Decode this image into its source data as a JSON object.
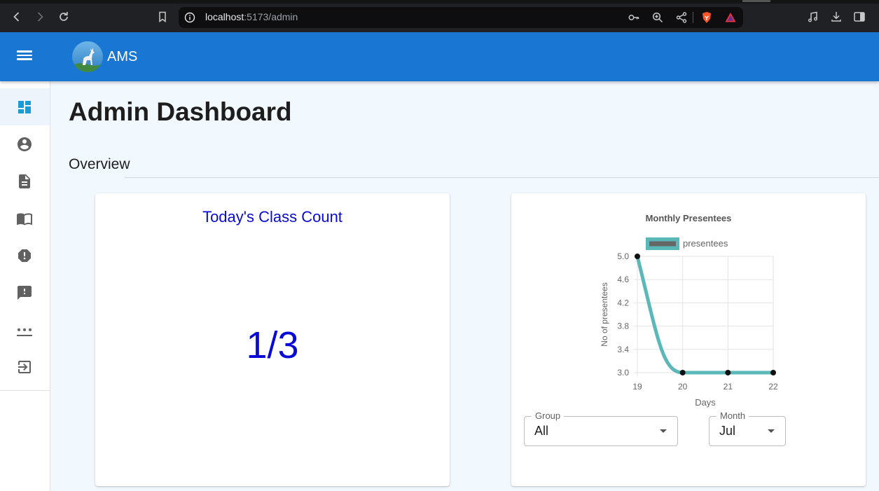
{
  "browser": {
    "url_host": "localhost",
    "url_path": ":5173/admin"
  },
  "appbar": {
    "title": "AMS"
  },
  "sidebar": {
    "items": [
      {
        "icon": "dashboard-icon",
        "active": true
      },
      {
        "icon": "account-circle-icon",
        "active": false
      },
      {
        "icon": "document-icon",
        "active": false
      },
      {
        "icon": "menu-book-icon",
        "active": false
      },
      {
        "icon": "report-icon",
        "active": false
      },
      {
        "icon": "feedback-icon",
        "active": false
      },
      {
        "icon": "password-icon",
        "active": false
      },
      {
        "icon": "logout-icon",
        "active": false
      }
    ]
  },
  "main": {
    "title": "Admin Dashboard",
    "section": "Overview",
    "class_count": {
      "title": "Today's Class Count",
      "value": "1/3"
    },
    "filters": {
      "group": {
        "label": "Group",
        "value": "All"
      },
      "month": {
        "label": "Month",
        "value": "Jul"
      }
    }
  },
  "colors": {
    "appbar": "#1976d2",
    "accent_text": "#0a0ad6",
    "line": "#5ab8b8",
    "active_icon": "#1b9ad8",
    "icon": "#616161"
  },
  "chart_data": {
    "type": "line",
    "title": "Monthly Presentees",
    "xlabel": "Days",
    "ylabel": "No of presentees",
    "x": [
      19,
      20,
      21,
      22
    ],
    "series": [
      {
        "name": "presentees",
        "values": [
          5,
          3,
          3,
          3
        ]
      }
    ],
    "ylim": [
      3.0,
      5.0
    ],
    "yticks": [
      "3.0",
      "3.4",
      "3.8",
      "4.2",
      "4.6",
      "5.0"
    ],
    "xticks": [
      "19",
      "20",
      "21",
      "22"
    ],
    "grid": true,
    "legend": "top"
  }
}
